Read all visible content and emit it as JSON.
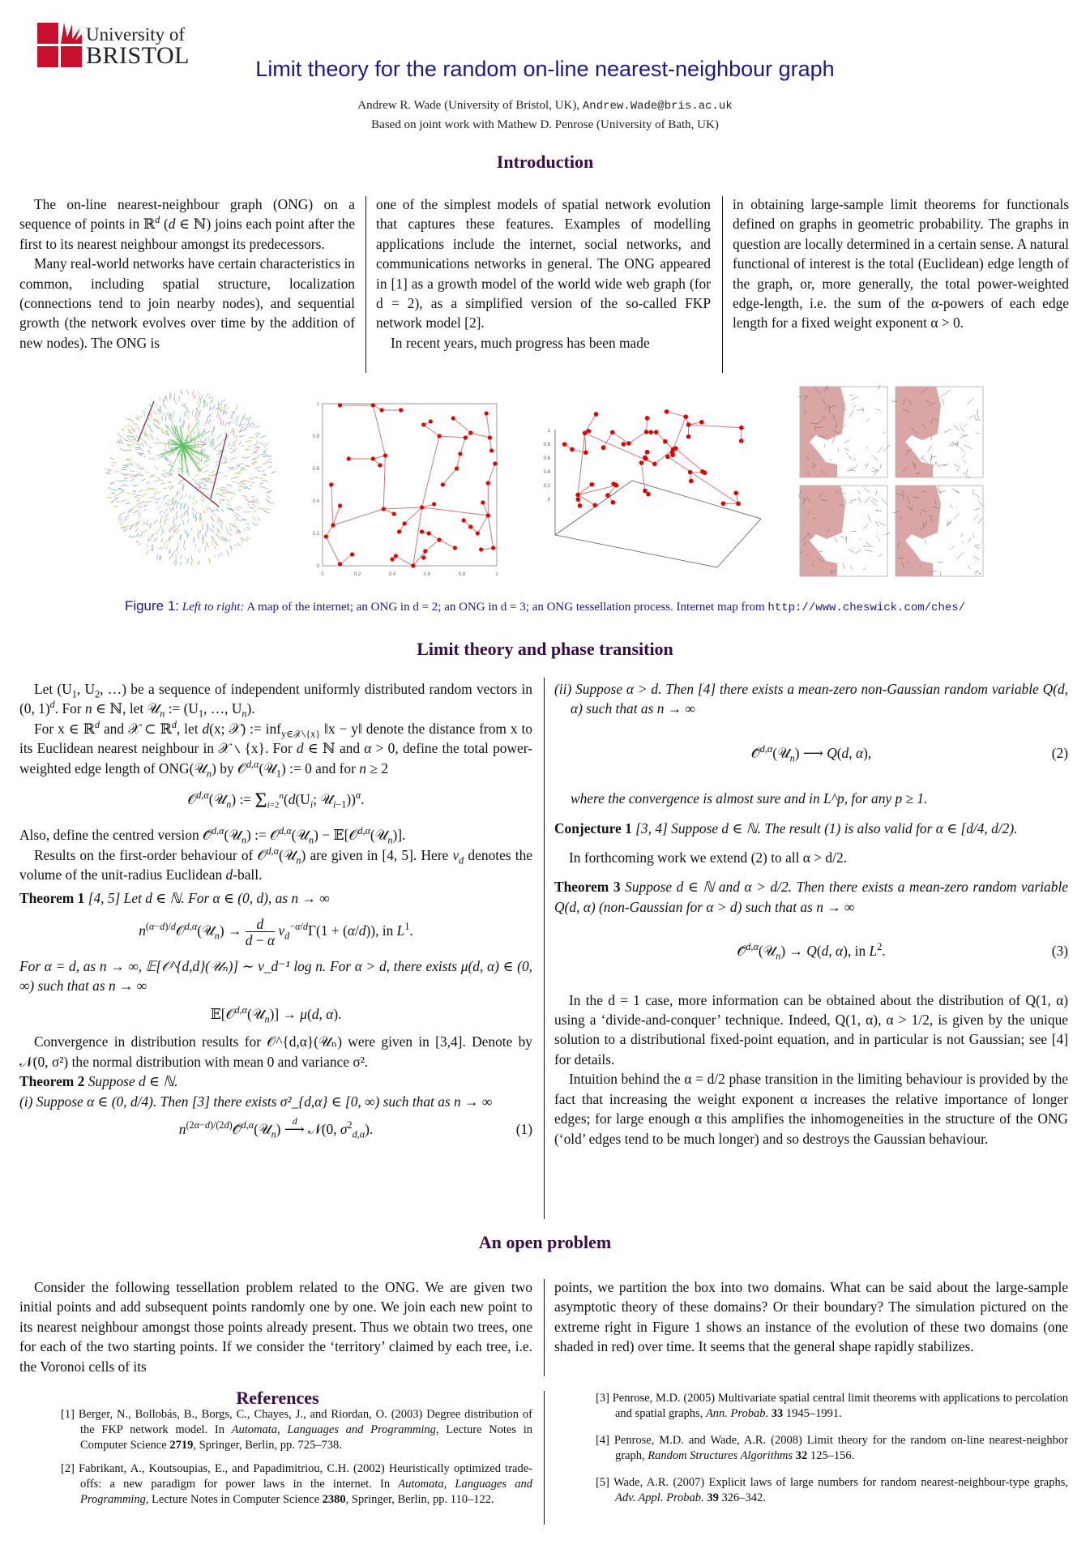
{
  "logo": {
    "line1": "University of",
    "line2": "BRISTOL",
    "color": "#c8102e"
  },
  "header": {
    "title": "Limit theory for the random on-line nearest-neighbour graph",
    "author": "Andrew R. Wade (University of Bristol, UK),",
    "email": "Andrew.Wade@bris.ac.uk",
    "based_on": "Based on joint work with Mathew D. Penrose (University of Bath, UK)"
  },
  "sections": {
    "introduction": "Introduction",
    "limit_theory": "Limit theory and phase transition",
    "open_problem": "An open problem",
    "references": "References"
  },
  "intro": {
    "col1_p1": "The on-line nearest-neighbour graph (ONG) on a sequence of points in ℝ^d (d ∈ ℕ) joins each point after the first to its nearest neighbour amongst its predecessors.",
    "col1_p2": "Many real-world networks have certain characteristics in common, including spatial structure, localization (connections tend to join nearby nodes), and sequential growth (the network evolves over time by the addition of new nodes). The ONG is",
    "col2_p1": "one of the simplest models of spatial network evolution that captures these features. Examples of modelling applications include the internet, social networks, and communications networks in general. The ONG appeared in [1] as a growth model of the world wide web graph (for d = 2), as a simplified version of the so-called FKP network model [2].",
    "col2_p2": "In recent years, much progress has been made",
    "col3_p1": "in obtaining large-sample limit theorems for functionals defined on graphs in geometric probability. The graphs in question are locally determined in a certain sense. A natural functional of interest is the total (Euclidean) edge length of the graph, or, more generally, the total power-weighted edge-length, i.e. the sum of the α-powers of each edge length for a fixed weight exponent α > 0."
  },
  "figure": {
    "label": "Figure 1:",
    "lead": "Left to right:",
    "caption": "A map of the internet; an ONG in d = 2; an ONG in d = 3; an ONG tessellation process. Internet map from",
    "url": "http://www.cheswick.com/ches/",
    "panels": [
      "internet-map",
      "ong-2d",
      "ong-3d",
      "ong-tessellation"
    ]
  },
  "chart_data": {
    "type": "scatter",
    "title": "ONG in d = 2",
    "xlabel": "",
    "ylabel": "",
    "xlim": [
      0,
      1
    ],
    "ylim": [
      0,
      1
    ],
    "xticks": [
      "0",
      "0.2",
      "0.4",
      "0.6",
      "0.8",
      "1"
    ],
    "yticks": [
      "0",
      "0.2",
      "0.4",
      "0.6",
      "0.8",
      "1"
    ],
    "points": [
      [
        0.1,
        0.99
      ],
      [
        0.29,
        0.99
      ],
      [
        0.34,
        0.96
      ],
      [
        0.45,
        0.96
      ],
      [
        0.58,
        0.87
      ],
      [
        0.62,
        0.89
      ],
      [
        0.67,
        0.8
      ],
      [
        0.82,
        0.79
      ],
      [
        0.75,
        0.91
      ],
      [
        0.85,
        0.82
      ],
      [
        0.96,
        0.79
      ],
      [
        0.94,
        0.94
      ],
      [
        0.97,
        0.71
      ],
      [
        0.79,
        0.69
      ],
      [
        0.77,
        0.6
      ],
      [
        0.69,
        0.5
      ],
      [
        0.36,
        0.68
      ],
      [
        0.29,
        0.66
      ],
      [
        0.15,
        0.66
      ],
      [
        0.33,
        0.62
      ],
      [
        0.99,
        0.63
      ],
      [
        0.95,
        0.51
      ],
      [
        0.05,
        0.5
      ],
      [
        0.92,
        0.39
      ],
      [
        0.1,
        0.37
      ],
      [
        0.35,
        0.35
      ],
      [
        0.57,
        0.36
      ],
      [
        0.64,
        0.38
      ],
      [
        0.41,
        0.32
      ],
      [
        0.95,
        0.31
      ],
      [
        0.06,
        0.25
      ],
      [
        0.81,
        0.28
      ],
      [
        0.47,
        0.26
      ],
      [
        0.85,
        0.24
      ],
      [
        0.44,
        0.21
      ],
      [
        0.57,
        0.21
      ],
      [
        0.61,
        0.2
      ],
      [
        0.89,
        0.2
      ],
      [
        0.02,
        0.18
      ],
      [
        0.67,
        0.16
      ],
      [
        0.76,
        0.11
      ],
      [
        0.98,
        0.11
      ],
      [
        0.91,
        0.1
      ],
      [
        0.59,
        0.09
      ],
      [
        0.17,
        0.07
      ],
      [
        0.42,
        0.06
      ],
      [
        0.58,
        0.05
      ],
      [
        0.4,
        0.04
      ],
      [
        0.1,
        0.01
      ],
      [
        0.52,
        0.0
      ]
    ],
    "edges": [
      [
        0,
        1
      ],
      [
        1,
        2
      ],
      [
        2,
        3
      ],
      [
        1,
        16
      ],
      [
        16,
        17
      ],
      [
        17,
        18
      ],
      [
        17,
        19
      ],
      [
        16,
        25
      ],
      [
        25,
        28
      ],
      [
        25,
        30
      ],
      [
        30,
        22
      ],
      [
        30,
        24
      ],
      [
        30,
        38
      ],
      [
        38,
        48
      ],
      [
        48,
        44
      ],
      [
        25,
        26
      ],
      [
        26,
        27
      ],
      [
        26,
        32
      ],
      [
        32,
        34
      ],
      [
        26,
        6
      ],
      [
        6,
        4
      ],
      [
        4,
        5
      ],
      [
        6,
        7
      ],
      [
        7,
        13
      ],
      [
        13,
        14
      ],
      [
        14,
        15
      ],
      [
        7,
        9
      ],
      [
        9,
        8
      ],
      [
        9,
        10
      ],
      [
        10,
        11
      ],
      [
        10,
        12
      ],
      [
        26,
        29
      ],
      [
        29,
        21
      ],
      [
        21,
        20
      ],
      [
        29,
        23
      ],
      [
        29,
        37
      ],
      [
        37,
        33
      ],
      [
        33,
        31
      ],
      [
        29,
        41
      ],
      [
        41,
        42
      ],
      [
        26,
        49
      ],
      [
        49,
        45
      ],
      [
        45,
        47
      ],
      [
        49,
        43
      ],
      [
        43,
        46
      ],
      [
        43,
        39
      ],
      [
        39,
        36
      ],
      [
        36,
        35
      ],
      [
        39,
        40
      ]
    ]
  },
  "limit": {
    "p1": "Let (U₁, U₂, …) be a sequence of independent uniformly distributed random vectors in (0, 1)^d. For n ∈ ℕ, let 𝒰ₙ := (U₁, …, Uₙ).",
    "p2": "For x ∈ ℝ^d and 𝒳 ⊂ ℝ^d, let d(x; 𝒳) := inf_{y∈𝒳∖{x}} ‖x − y‖ denote the distance from x to its Euclidean nearest neighbour in 𝒳 ∖ {x}. For d ∈ ℕ and α > 0, define the total power-weighted edge length of ONG(𝒰ₙ) by 𝒪^{d,α}(𝒰₁) := 0 and for n ≥ 2",
    "eq_def": "𝒪^{d,α}(𝒰ₙ) := Σ_{i=2}^{n} (d(Uᵢ; 𝒰ᵢ₋₁))^α.",
    "p3": "Also, define the centred version 𝒪̃^{d,α}(𝒰ₙ) := 𝒪^{d,α}(𝒰ₙ) − 𝔼[𝒪^{d,α}(𝒰ₙ)].",
    "p4": "Results on the first-order behaviour of 𝒪^{d,α}(𝒰ₙ) are given in [4, 5]. Here v_d denotes the volume of the unit-radius Euclidean d-ball.",
    "thm1_label": "Theorem 1",
    "thm1_text": "[4, 5] Let d ∈ ℕ. For α ∈ (0, d), as n → ∞",
    "thm1_eq": "n^{(α−d)/d} 𝒪^{d,α}(𝒰ₙ) → d/(d − α) · v_d^{−α/d} Γ(1 + (α/d)),  in L¹.",
    "thm1_cont": "For α = d, as n → ∞, 𝔼[𝒪^{d,d}(𝒰ₙ)] ∼ v_d⁻¹ log n. For α > d, there exists μ(d, α) ∈ (0, ∞) such that as n → ∞",
    "thm1_eq2": "𝔼[𝒪^{d,α}(𝒰ₙ)] → μ(d, α).",
    "p5": "Convergence in distribution results for 𝒪^{d,α}(𝒰ₙ) were given in [3,4]. Denote by 𝒩(0, σ²) the normal distribution with mean 0 and variance σ².",
    "thm2_label": "Theorem 2",
    "thm2_text": "Suppose d ∈ ℕ.",
    "thm2_i": "(i) Suppose α ∈ (0, d/4). Then [3] there exists σ²_{d,α} ∈ [0, ∞) such that as n → ∞",
    "eq1": "n^{(2α−d)/(2d)} 𝒪̃^{d,α}(𝒰ₙ) —d→ 𝒩(0, σ²_{d,α}).",
    "eq1_num": "(1)",
    "thm2_ii": "(ii) Suppose α > d. Then [4] there exists a mean-zero non-Gaussian random variable Q(d, α) such that as n → ∞",
    "eq2": "𝒪̃^{d,α}(𝒰ₙ) ⟶ Q(d, α),",
    "eq2_num": "(2)",
    "thm2_ii_cont": "where the convergence is almost sure and in L^p, for any p ≥ 1.",
    "conj_label": "Conjecture 1",
    "conj_text": "[3, 4] Suppose d ∈ ℕ. The result (1) is also valid for α ∈ [d/4, d/2).",
    "forthcoming": "In forthcoming work we extend (2) to all α > d/2.",
    "thm3_label": "Theorem 3",
    "thm3_text": "Suppose d ∈ ℕ and α > d/2. Then there exists a mean-zero random variable Q(d, α) (non-Gaussian for α > d) such that as n → ∞",
    "eq3": "𝒪̃^{d,α}(𝒰ₙ) → Q(d, α),  in L².",
    "eq3_num": "(3)",
    "p6": "In the d = 1 case, more information can be obtained about the distribution of Q(1, α) using a ‘divide-and-conquer’ technique. Indeed, Q(1, α), α > 1/2, is given by the unique solution to a distributional fixed-point equation, and in particular is not Gaussian; see [4] for details.",
    "p7": "Intuition behind the α = d/2 phase transition in the limiting behaviour is provided by the fact that increasing the weight exponent α increases the relative importance of longer edges; for large enough α this amplifies the inhomogeneities in the structure of the ONG (‘old’ edges tend to be much longer) and so destroys the Gaussian behaviour."
  },
  "open_problem": {
    "col1": "Consider the following tessellation problem related to the ONG. We are given two initial points and add subsequent points randomly one by one. We join each new point to its nearest neighbour amongst those points already present. Thus we obtain two trees, one for each of the two starting points. If we consider the ‘territory’ claimed by each tree, i.e. the Voronoi cells of its",
    "col2": "points, we partition the box into two domains. What can be said about the large-sample asymptotic theory of these domains? Or their boundary? The simulation pictured on the extreme right in Figure 1 shows an instance of the evolution of these two domains (one shaded in red) over time. It seems that the general shape rapidly stabilizes."
  },
  "references": [
    "[1] Berger, N., Bollobás, B., Borgs, C., Chayes, J., and Riordan, O. (2003) Degree distribution of the FKP network model. In Automata, Languages and Programming, Lecture Notes in Computer Science 2719, Springer, Berlin, pp. 725–738.",
    "[2] Fabrikant, A., Koutsoupias, E., and Papadimitriou, C.H. (2002) Heuristically optimized trade-offs: a new paradigm for power laws in the internet. In Automata, Languages and Programming, Lecture Notes in Computer Science 2380, Springer, Berlin, pp. 110–122.",
    "[3] Penrose, M.D. (2005) Multivariate spatial central limit theorems with applications to percolation and spatial graphs, Ann. Probab. 33 1945–1991.",
    "[4] Penrose, M.D. and Wade, A.R. (2008) Limit theory for the random on-line nearest-neighbor graph, Random Structures Algorithms 32 125–156.",
    "[5] Wade, A.R. (2007) Explicit laws of large numbers for random nearest-neighbour-type graphs, Adv. Appl. Probab. 39 326–342."
  ]
}
